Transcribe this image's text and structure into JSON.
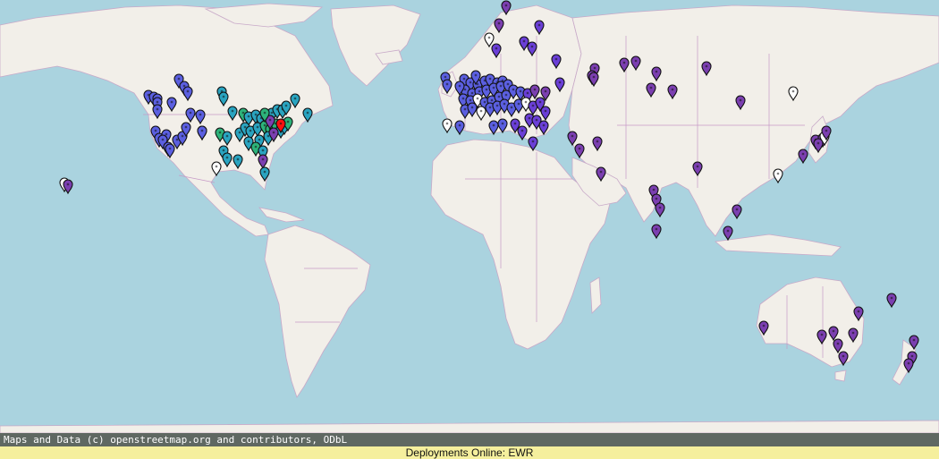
{
  "attribution": "Maps and Data (c) openstreetmap.org and contributors, ODbL",
  "status": "Deployments Online: EWR",
  "colors": {
    "ocean": "#aad3df",
    "land": "#f2efe9",
    "border": "#c79ac7",
    "attribution_bg": "#5f6862",
    "status_bg": "#f5ef9d"
  },
  "marker_colors": {
    "blue": "#5b5fe0",
    "teal": "#2aa4c0",
    "green": "#2db37a",
    "purple": "#7b3fb0",
    "violet": "#6a3fd6",
    "white": "#ffffff",
    "red": "#ff1010"
  },
  "highlighted_marker": "EWR"
}
